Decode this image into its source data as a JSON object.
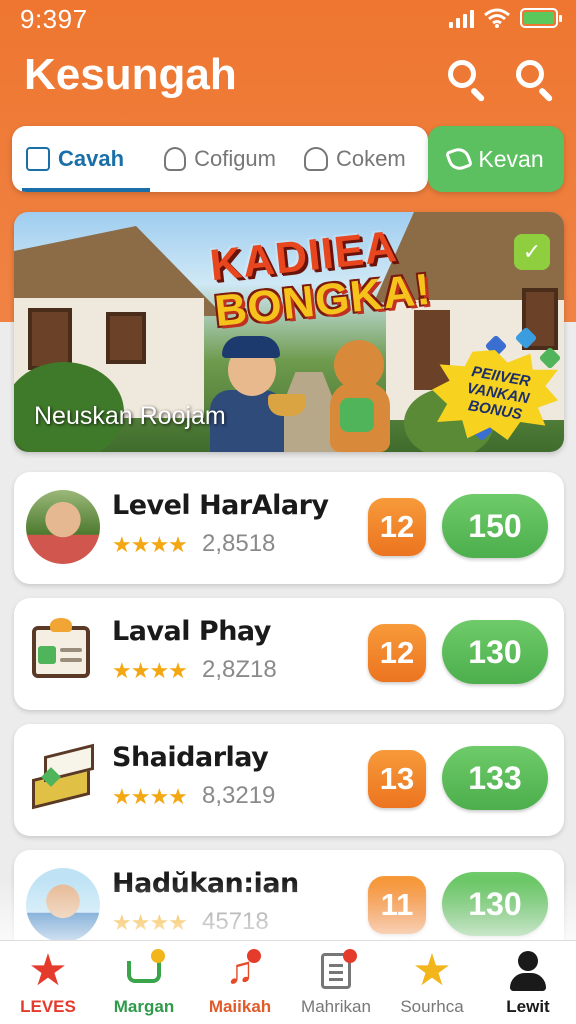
{
  "status_bar": {
    "time": "9:397"
  },
  "header": {
    "title": "Kesungah"
  },
  "tabs": [
    {
      "label": "Cavah",
      "icon": "bag-icon",
      "active": true
    },
    {
      "label": "Cofigum",
      "icon": "person-icon",
      "active": false
    },
    {
      "label": "Cokem",
      "icon": "people-icon",
      "active": false
    }
  ],
  "action_button": {
    "label": "Kevan",
    "icon": "leaf-icon"
  },
  "banner": {
    "title_line1": "KADIIEA",
    "title_line2": "BONGKA!",
    "caption": "Neuskan Roojam",
    "bonus_text": "PEIIVER VANKAN BONUS",
    "check_mark": "✓"
  },
  "levels": [
    {
      "title": "Level HarAlary",
      "stars": "★★★★",
      "count": "2,8518",
      "level": "12",
      "score": "150",
      "avatar": "farmer-avatar"
    },
    {
      "title": "Laval Phay",
      "stars": "★★★★",
      "count": "2,8Z18",
      "level": "12",
      "score": "130",
      "avatar": "clipboard-icon"
    },
    {
      "title": "Shaidarlay",
      "stars": "★★★★",
      "count": "8,3219",
      "level": "13",
      "score": "133",
      "avatar": "books-icon"
    },
    {
      "title": "Hadŭkan:ian",
      "stars": "★★★★",
      "count": "45718",
      "level": "11",
      "score": "130",
      "avatar": "kid-avatar"
    }
  ],
  "bottom_nav": [
    {
      "label": "LEVES",
      "icon": "star-icon",
      "color": "#e53b2c"
    },
    {
      "label": "Margan",
      "icon": "cart-icon",
      "color": "#2f9a4a"
    },
    {
      "label": "Maiikah",
      "icon": "music-note-icon",
      "color": "#e05a2a"
    },
    {
      "label": "Mahrikan",
      "icon": "document-icon",
      "color": "#777777"
    },
    {
      "label": "Sourhca",
      "icon": "gold-star-icon",
      "color": "#777777"
    },
    {
      "label": "Lewit",
      "icon": "person-icon",
      "color": "#1a1a1a"
    }
  ],
  "colors": {
    "header_orange": "#ee7630",
    "accent_green": "#5cbf60",
    "badge_orange": "#ec7420",
    "tab_blue": "#1a6fa8"
  }
}
